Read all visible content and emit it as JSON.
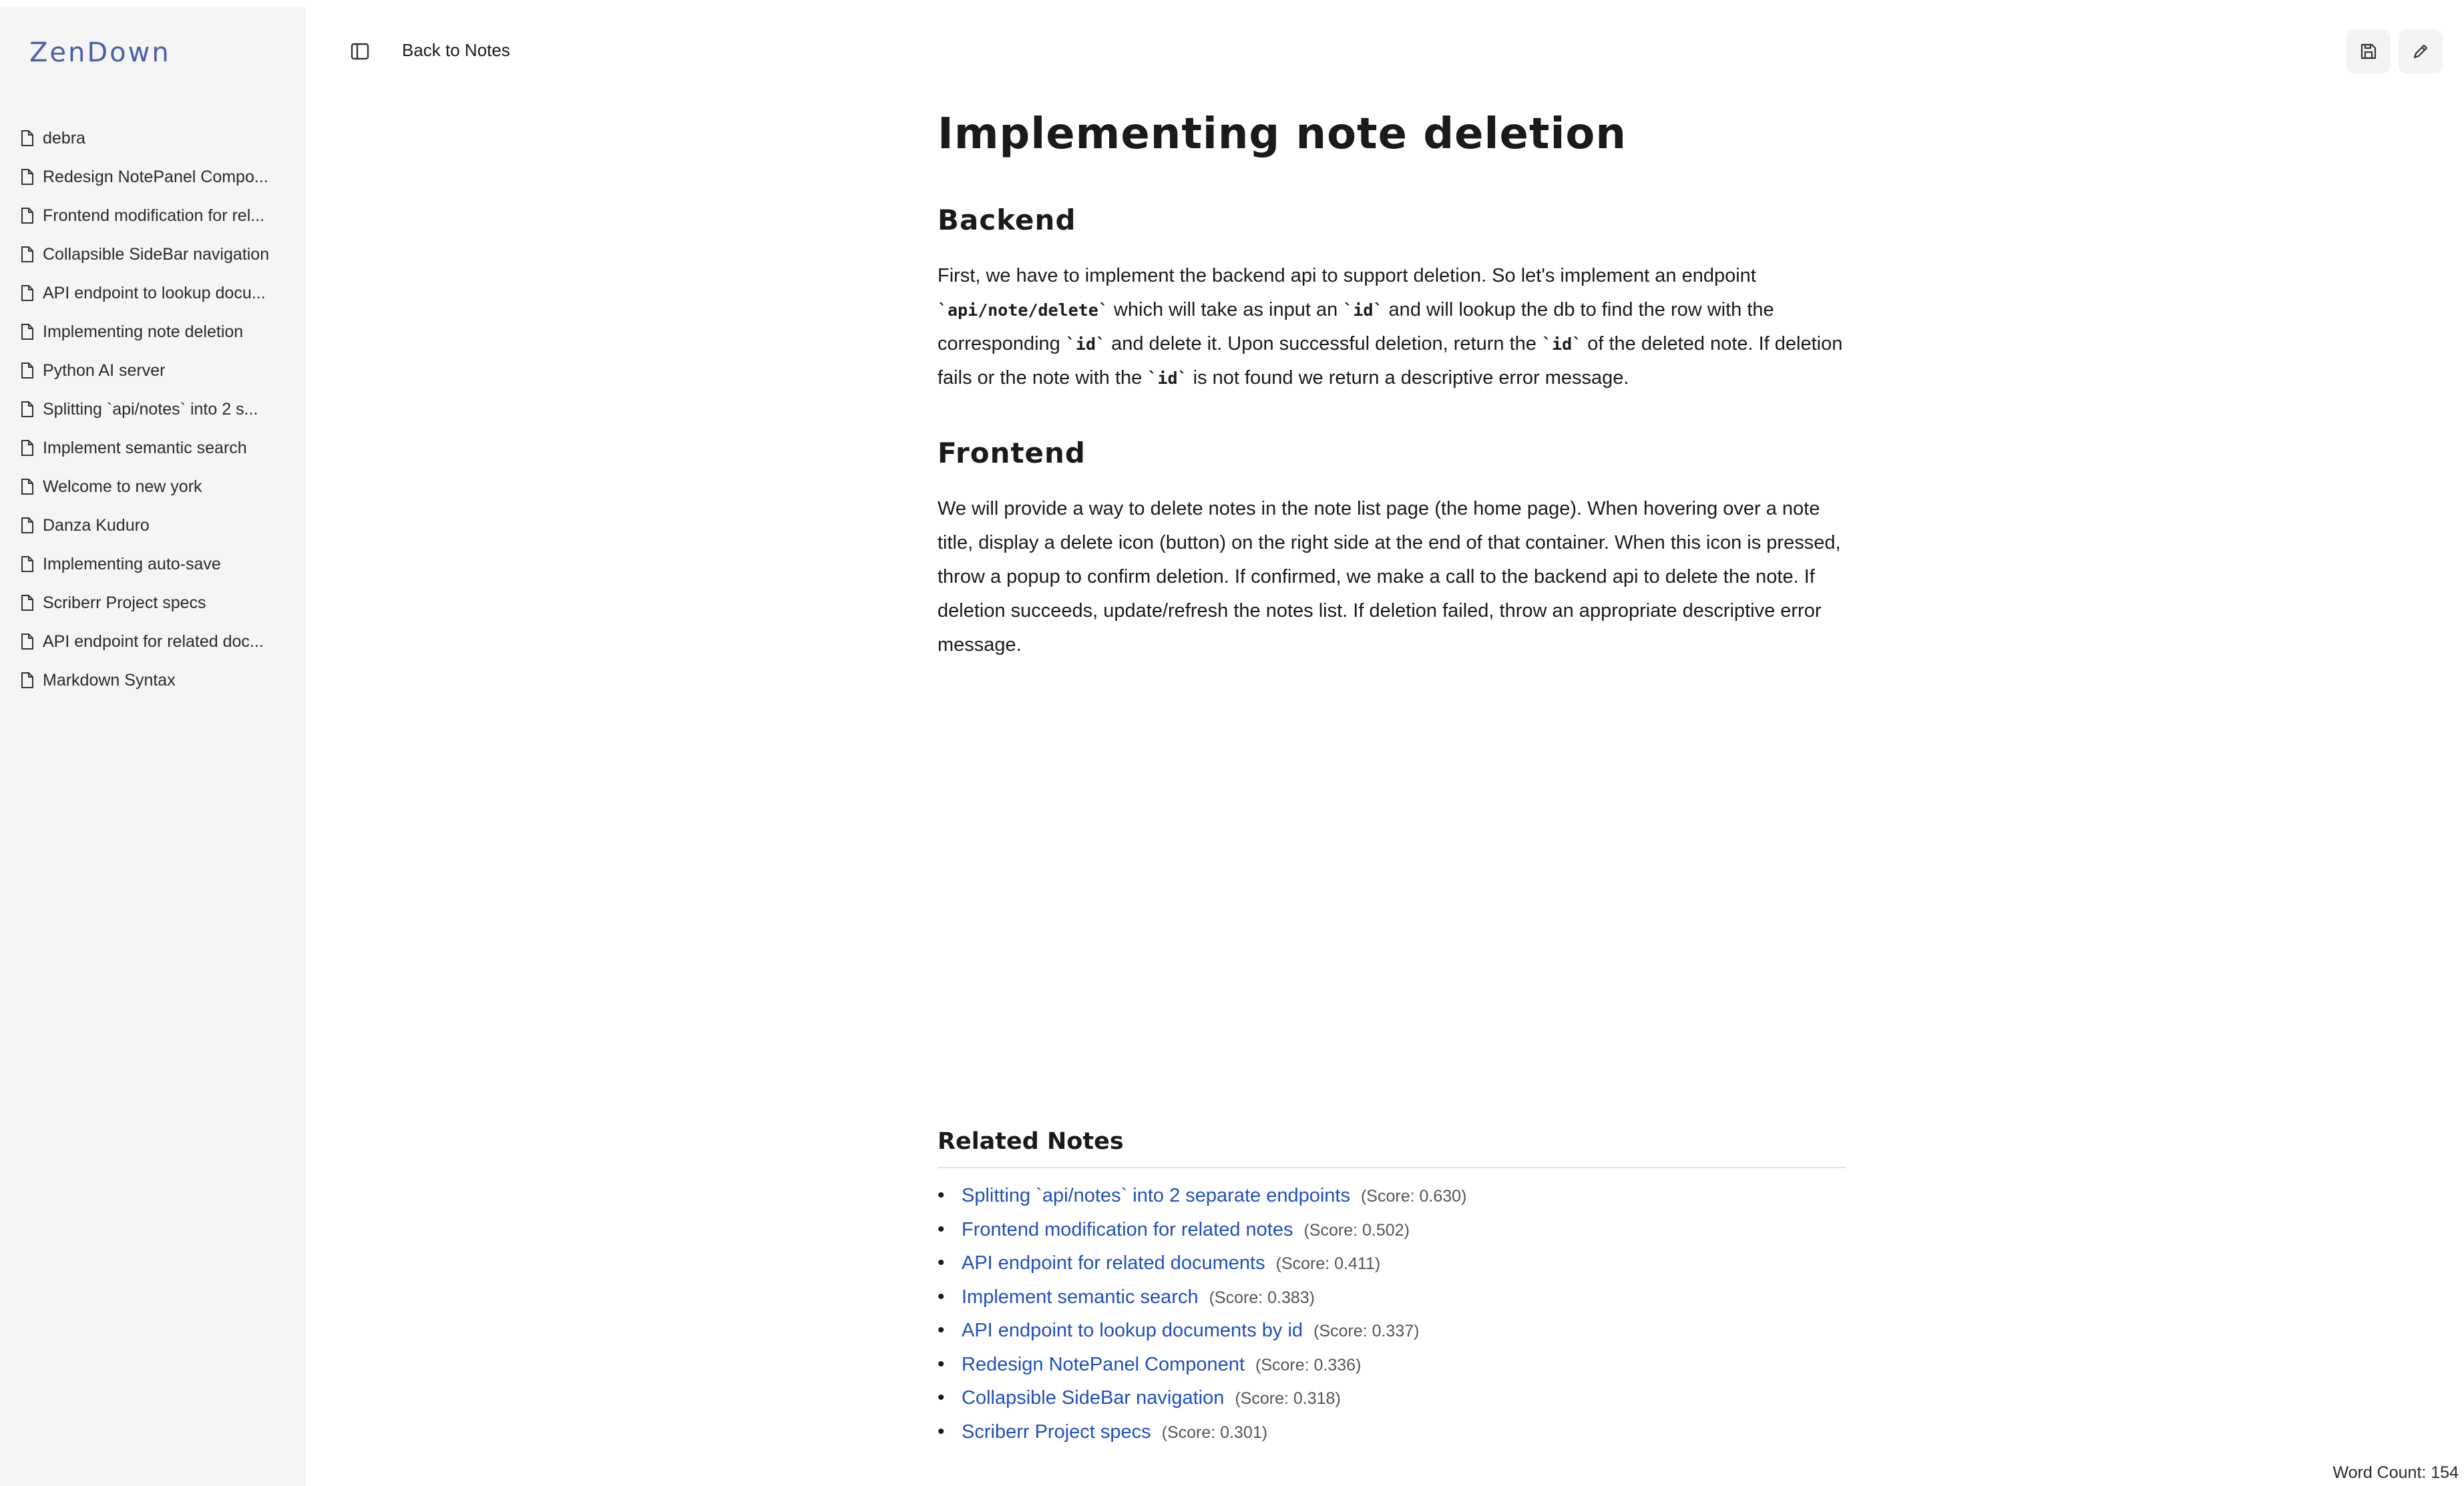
{
  "app": {
    "logo_text": "ZenDown"
  },
  "sidebar": {
    "items": [
      {
        "label": "debra"
      },
      {
        "label": "Redesign NotePanel Compo..."
      },
      {
        "label": "Frontend modification for rel..."
      },
      {
        "label": "Collapsible SideBar navigation"
      },
      {
        "label": "API endpoint to lookup docu..."
      },
      {
        "label": "Implementing note deletion"
      },
      {
        "label": "Python AI server"
      },
      {
        "label": "Splitting `api/notes` into 2 s..."
      },
      {
        "label": "Implement semantic search"
      },
      {
        "label": "Welcome to new york"
      },
      {
        "label": "Danza Kuduro"
      },
      {
        "label": "Implementing auto-save"
      },
      {
        "label": "Scriberr Project specs"
      },
      {
        "label": "API endpoint for related doc..."
      },
      {
        "label": "Markdown Syntax"
      }
    ]
  },
  "toolbar": {
    "back_label": "Back to Notes",
    "toggle_icon": "sidebar-toggle-icon",
    "save_icon": "save-icon",
    "edit_icon": "pencil-icon"
  },
  "document": {
    "title": "Implementing note deletion",
    "sections": [
      {
        "heading": "Backend",
        "p1": "First, we have to implement the backend api to support deletion. So let's implement an endpoint ",
        "c1": "`api/note/delete`",
        "p2": " which will take as input an ",
        "c2": "`id`",
        "p3": " and will lookup the db to find the row with the corresponding ",
        "c3": "`id`",
        "p4": " and delete it. Upon successful deletion, return the ",
        "c4": "`id`",
        "p5": " of the deleted note. If deletion fails or the note with the ",
        "c5": "`id`",
        "p6": " is not found we return a descriptive error message."
      },
      {
        "heading": "Frontend",
        "text": "We will provide a way to delete notes in the note list page (the home page). When hovering over a note title, display a delete icon (button) on the right side at the end of that container. When this icon is pressed, throw a popup to confirm deletion. If confirmed, we make a call to the backend api to delete the note. If deletion succeeds, update/refresh the notes list. If deletion failed, throw an appropriate descriptive error message."
      }
    ]
  },
  "related": {
    "heading": "Related Notes",
    "bullet": "•",
    "items": [
      {
        "title": "Splitting `api/notes` into 2 separate endpoints",
        "score": "(Score: 0.630)"
      },
      {
        "title": "Frontend modification for related notes",
        "score": "(Score: 0.502)"
      },
      {
        "title": "API endpoint for related documents",
        "score": "(Score: 0.411)"
      },
      {
        "title": "Implement semantic search",
        "score": "(Score: 0.383)"
      },
      {
        "title": "API endpoint to lookup documents by id",
        "score": "(Score: 0.337)"
      },
      {
        "title": "Redesign NotePanel Component",
        "score": "(Score: 0.336)"
      },
      {
        "title": "Collapsible SideBar navigation",
        "score": "(Score: 0.318)"
      },
      {
        "title": "Scriberr Project specs",
        "score": "(Score: 0.301)"
      }
    ]
  },
  "footer": {
    "word_count": "Word Count: 154"
  },
  "colors": {
    "link": "#1f4fbf",
    "logo": "#4a5fa8",
    "sidebar_bg": "#f5f5f5"
  }
}
